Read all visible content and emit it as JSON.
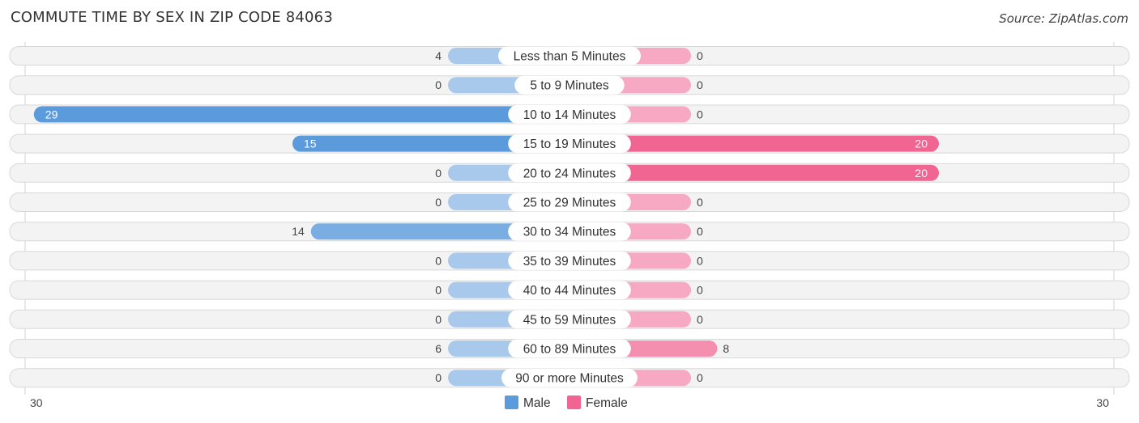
{
  "header": {
    "title": "COMMUTE TIME BY SEX IN ZIP CODE 84063",
    "source": "Source: ZipAtlas.com"
  },
  "colors": {
    "male_strong": "#5b9bdc",
    "male_light": "#a9c9ec",
    "female_strong": "#f06592",
    "female_light": "#f7a8c2",
    "row_background": "#f3f3f3"
  },
  "chart_data": {
    "type": "bar",
    "orientation": "horizontal-diverging",
    "title": "COMMUTE TIME BY SEX IN ZIP CODE 84063",
    "categories": [
      "Less than 5 Minutes",
      "5 to 9 Minutes",
      "10 to 14 Minutes",
      "15 to 19 Minutes",
      "20 to 24 Minutes",
      "25 to 29 Minutes",
      "30 to 34 Minutes",
      "35 to 39 Minutes",
      "40 to 44 Minutes",
      "45 to 59 Minutes",
      "60 to 89 Minutes",
      "90 or more Minutes"
    ],
    "series": [
      {
        "name": "Male",
        "side": "left",
        "values": [
          4,
          0,
          29,
          15,
          0,
          0,
          14,
          0,
          0,
          0,
          6,
          0
        ]
      },
      {
        "name": "Female",
        "side": "right",
        "values": [
          0,
          0,
          0,
          20,
          20,
          0,
          0,
          0,
          0,
          0,
          8,
          0
        ]
      }
    ],
    "axis": {
      "left_label": "30",
      "right_label": "30",
      "max": 30
    },
    "legend": {
      "position": "bottom-center",
      "items": [
        "Male",
        "Female"
      ]
    },
    "xlabel": "",
    "ylabel": ""
  }
}
